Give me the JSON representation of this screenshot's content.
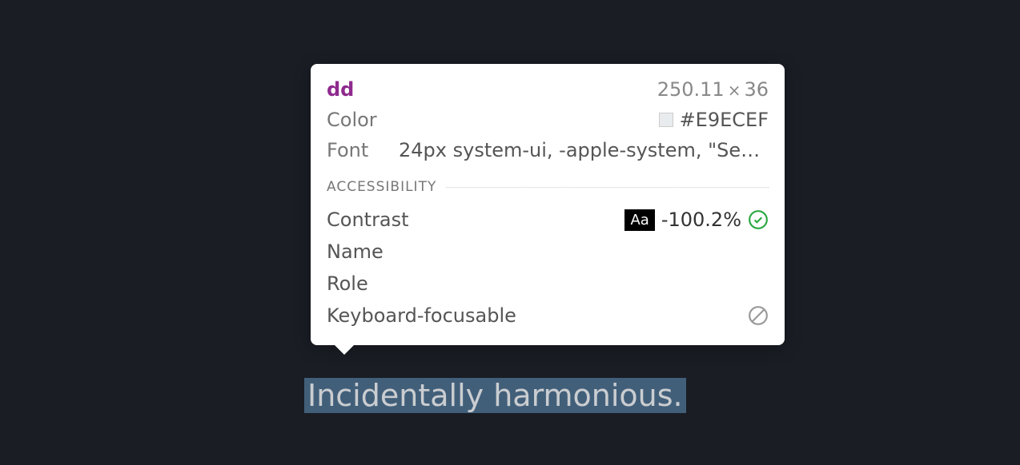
{
  "highlighted_text": "Incidentally harmonious.",
  "tooltip": {
    "tag_name": "dd",
    "dimensions": {
      "width": "250.11",
      "height": "36"
    },
    "color": {
      "label": "Color",
      "value": "#E9ECEF",
      "swatch": "#E9ECEF"
    },
    "font": {
      "label": "Font",
      "value": "24px system-ui, -apple-system, \"Segoe…"
    },
    "accessibility": {
      "section_title": "ACCESSIBILITY",
      "contrast": {
        "label": "Contrast",
        "badge": "Aa",
        "value": "-100.2%"
      },
      "name": {
        "label": "Name",
        "value": ""
      },
      "role": {
        "label": "Role",
        "value": ""
      },
      "keyboard_focusable": {
        "label": "Keyboard-focusable"
      }
    }
  }
}
